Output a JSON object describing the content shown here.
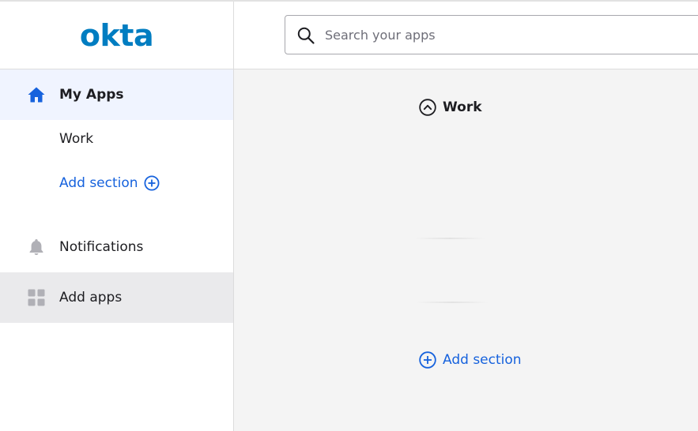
{
  "sidebar": {
    "logo": {
      "text": "okta",
      "color": "#007dc1"
    },
    "items": [
      {
        "label": "My Apps",
        "icon": "home-icon",
        "active": true
      },
      {
        "label": "Work"
      },
      {
        "label": "Add section",
        "icon": "plus-circle-icon"
      },
      {
        "label": "Notifications",
        "icon": "bell-icon"
      },
      {
        "label": "Add apps",
        "icon": "apps-grid-icon"
      }
    ]
  },
  "header": {
    "search": {
      "placeholder": "Search your apps",
      "value": ""
    }
  },
  "main": {
    "section": {
      "title": "Work",
      "icon": "chevron-up-circle-icon"
    },
    "add_section_label": "Add section"
  },
  "colors": {
    "accent": "#1662dd",
    "brand": "#007dc1",
    "active_bg": "#f0f4ff",
    "hover_bg": "#eaeaec",
    "main_bg": "#f4f4f4"
  }
}
